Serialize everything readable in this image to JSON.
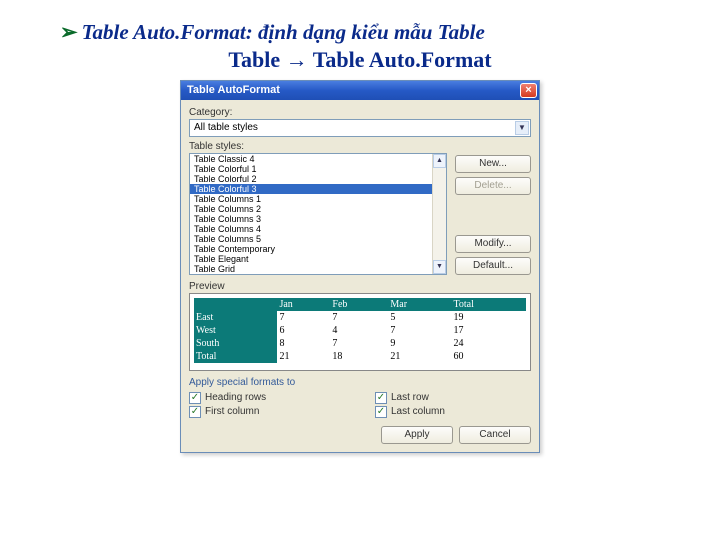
{
  "heading": {
    "bullet": "➢",
    "line1": "Table Auto.Format: định dạng kiểu mẫu Table",
    "line2": "Table → Table Auto.Format"
  },
  "dialog": {
    "title": "Table AutoFormat",
    "close": "×",
    "category_label": "Category:",
    "category_value": "All table styles",
    "styles_label": "Table styles:",
    "styles": [
      "Table Classic 4",
      "Table Colorful 1",
      "Table Colorful 2",
      "Table Colorful 3",
      "Table Columns 1",
      "Table Columns 2",
      "Table Columns 3",
      "Table Columns 4",
      "Table Columns 5",
      "Table Contemporary",
      "Table Elegant",
      "Table Grid"
    ],
    "selected_index": 3,
    "buttons": {
      "new": "New...",
      "delete": "Delete...",
      "modify": "Modify...",
      "default": "Default..."
    },
    "preview_label": "Preview",
    "preview": {
      "cols": [
        "",
        "Jan",
        "Feb",
        "Mar",
        "Total"
      ],
      "rows": [
        {
          "h": "East",
          "c": [
            "7",
            "7",
            "5",
            "19"
          ]
        },
        {
          "h": "West",
          "c": [
            "6",
            "4",
            "7",
            "17"
          ]
        },
        {
          "h": "South",
          "c": [
            "8",
            "7",
            "9",
            "24"
          ]
        },
        {
          "h": "Total",
          "c": [
            "21",
            "18",
            "21",
            "60"
          ]
        }
      ]
    },
    "specials_label": "Apply special formats to",
    "checks": {
      "heading_rows": "Heading rows",
      "last_row": "Last row",
      "first_column": "First column",
      "last_column": "Last column"
    },
    "footer": {
      "apply": "Apply",
      "cancel": "Cancel"
    }
  }
}
